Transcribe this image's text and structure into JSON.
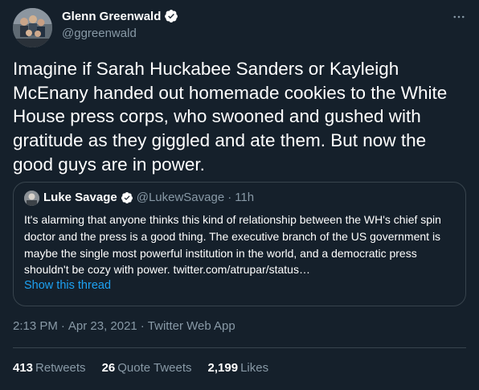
{
  "author": {
    "display_name": "Glenn Greenwald",
    "handle": "@ggreenwald",
    "avatar_icon": "family-photo-avatar",
    "verified": true
  },
  "tweet_text": "Imagine if Sarah Huckabee Sanders or Kayleigh McEnany handed out homemade cookies to the White House press corps, who swooned and gushed with gratitude as they giggled and ate them. But now the good guys are in power.",
  "quoted_tweet": {
    "display_name": "Luke Savage",
    "handle": "@LukewSavage",
    "dot": "·",
    "time": "11h",
    "verified": true,
    "text": "It's alarming that anyone thinks this kind of relationship between the WH's chief spin doctor and the press is a good thing. The executive branch of the US government is maybe the single most powerful institution in the world, and a democratic press shouldn't be cozy with power. twitter.com/atrupar/status…",
    "show_thread": "Show this thread"
  },
  "meta": {
    "time": "2:13 PM",
    "sep": "·",
    "date": "Apr 23, 2021",
    "source": "Twitter Web App"
  },
  "stats": [
    {
      "count": "413",
      "label": "Retweets"
    },
    {
      "count": "26",
      "label": "Quote Tweets"
    },
    {
      "count": "2,199",
      "label": "Likes"
    }
  ],
  "colors": {
    "background": "#15202b",
    "secondary_text": "#8899a6",
    "accent": "#1da1f2",
    "border": "#38444d"
  }
}
